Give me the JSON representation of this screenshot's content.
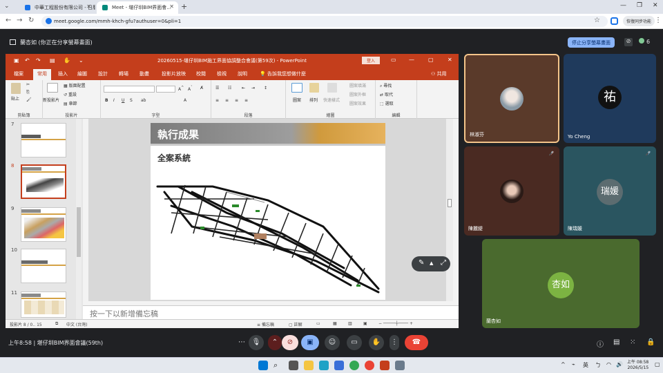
{
  "browser": {
    "tabs": [
      {
        "title": "中華工程股份有限公司 - 日曆...",
        "color": "#1a73e8"
      },
      {
        "title": "Meet - 堪仔圳BIM界面會...",
        "color": "#00897b"
      }
    ],
    "url": "meet.google.com/mmh-khch-gfu?authuser=0&pli=1",
    "pause_sync": "恢復同步功能"
  },
  "meet": {
    "presenting_label": "蘭杏如 (你正在分享螢幕畫面)",
    "stop_share": "停止分享螢幕畫面",
    "people_count": "6",
    "meeting_time": "上午8:58",
    "meeting_name": "堪仔圳BIM界面會議(59th)"
  },
  "ppt": {
    "title": "20260515-堪仔圳BIM施工界面協調整合會議(第59次)  -  PowerPoint",
    "login": "登入",
    "tabs": [
      "檔案",
      "常用",
      "插入",
      "繪圖",
      "設計",
      "轉場",
      "動畫",
      "投影片放映",
      "校閱",
      "檢視",
      "說明"
    ],
    "tell_me": "告訴我您想做什麼",
    "share": "共用",
    "ribbon": {
      "clipboard": "剪貼簿",
      "paste": "貼上",
      "slides": "投影片",
      "new_slide": "新投影片",
      "layout": "版面配置",
      "reset": "重設",
      "section": "章節",
      "font": "字型",
      "paragraph": "段落",
      "drawing": "繪圖",
      "shapes": "圖案",
      "arrange": "排列",
      "quick_styles": "快速樣式",
      "shape_fill": "圖案填滿",
      "shape_outline": "圖案外框",
      "shape_effects": "圖案效果",
      "editing": "編輯",
      "find": "尋找",
      "replace": "取代",
      "select": "選取"
    },
    "slide_numbers": [
      "7",
      "8",
      "9",
      "10",
      "11"
    ],
    "slide": {
      "title": "執行成果",
      "subtitle": "全案系統"
    },
    "notes_placeholder": "按一下以新增備忘稿",
    "status": {
      "slide_of": "投影片 8 / 0.. 15",
      "language": "中文 (台灣)",
      "notes": "備忘稿",
      "comments": "註解"
    }
  },
  "participants": [
    {
      "name": "林淑芬",
      "type": "photo",
      "bg": "#5a3a2a"
    },
    {
      "name": "Yo Cheng",
      "type": "logo",
      "bg": "#1f3a5c",
      "letter": "祐"
    },
    {
      "name": "陳麗緹",
      "type": "photo",
      "bg": "#4a2a22"
    },
    {
      "name": "陳瑞媛",
      "type": "letter",
      "bg": "#2a5560",
      "letter": "瑞媛"
    },
    {
      "name": "蘭杏如",
      "type": "letter",
      "bg": "#4a6a2e",
      "letter": "杏如"
    }
  ],
  "taskbar": {
    "ime": "英",
    "time": "上午 08:58",
    "date": "2026/5/15"
  }
}
